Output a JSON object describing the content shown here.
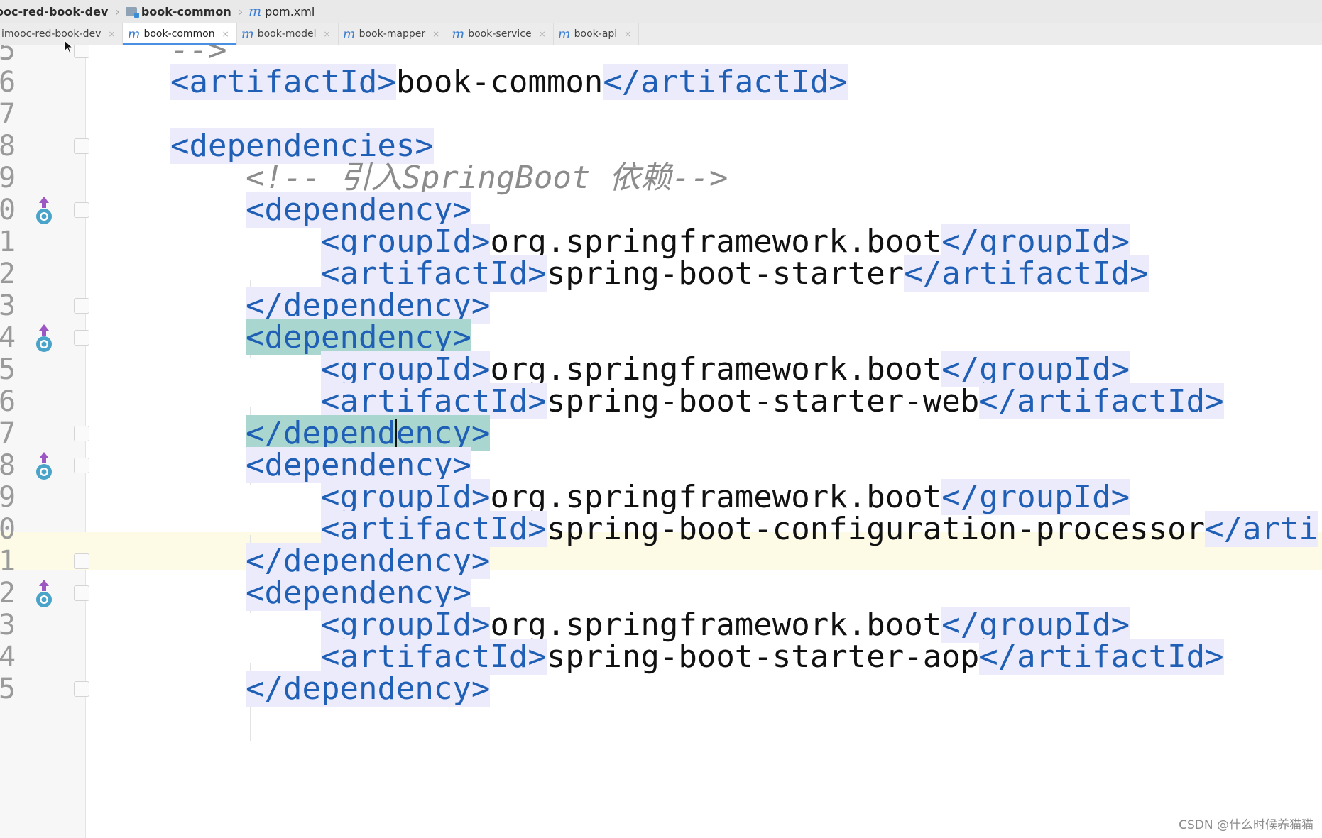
{
  "breadcrumb": [
    {
      "label": "ooc-red-book-dev",
      "icon": "none"
    },
    {
      "label": "book-common",
      "icon": "module-folder-icon"
    },
    {
      "label": "pom.xml",
      "icon": "maven-icon"
    }
  ],
  "tabs": [
    {
      "label": "imooc-red-book-dev",
      "icon": "none",
      "active": false
    },
    {
      "label": "book-common",
      "icon": "maven-icon",
      "active": true
    },
    {
      "label": "book-model",
      "icon": "maven-icon",
      "active": false
    },
    {
      "label": "book-mapper",
      "icon": "maven-icon",
      "active": false
    },
    {
      "label": "book-service",
      "icon": "maven-icon",
      "active": false
    },
    {
      "label": "book-api",
      "icon": "maven-icon",
      "active": false
    }
  ],
  "editor": {
    "lines": [
      {
        "num": "5",
        "text": "-->"
      },
      {
        "num": "6",
        "tag": "artifactId",
        "value": "book-common"
      },
      {
        "num": "7",
        "text": ""
      },
      {
        "num": "8",
        "tag": "dependencies"
      },
      {
        "num": "9",
        "comment": "<!-- 引入SpringBoot 依赖-->"
      },
      {
        "num": "0",
        "tag": "dependency"
      },
      {
        "num": "1",
        "tag": "groupId",
        "value": "org.springframework.boot"
      },
      {
        "num": "2",
        "tag": "artifactId",
        "value": "spring-boot-starter"
      },
      {
        "num": "3",
        "tag": "/dependency"
      },
      {
        "num": "4",
        "tag": "dependency"
      },
      {
        "num": "5",
        "tag": "groupId",
        "value": "org.springframework.boot"
      },
      {
        "num": "6",
        "tag": "artifactId",
        "value": "spring-boot-starter-web"
      },
      {
        "num": "7",
        "tag": "/dependency"
      },
      {
        "num": "8",
        "tag": "dependency"
      },
      {
        "num": "9",
        "tag": "groupId",
        "value": "org.springframework.boot"
      },
      {
        "num": "0",
        "tag": "artifactId",
        "value": "spring-boot-configuration-processor",
        "close": "</arti"
      },
      {
        "num": "1",
        "tag": "/dependency"
      },
      {
        "num": "2",
        "tag": "dependency"
      },
      {
        "num": "3",
        "tag": "groupId",
        "value": "org.springframework.boot"
      },
      {
        "num": "4",
        "tag": "artifactId",
        "value": "spring-boot-starter-aop"
      },
      {
        "num": "5",
        "tag": "/dependency"
      }
    ]
  },
  "watermark": "CSDN @什么时候养猫猫",
  "colors": {
    "tag": "#1f5fb5",
    "match_highlight": "#a9d7cf",
    "caret_line": "#fdfbe6"
  }
}
